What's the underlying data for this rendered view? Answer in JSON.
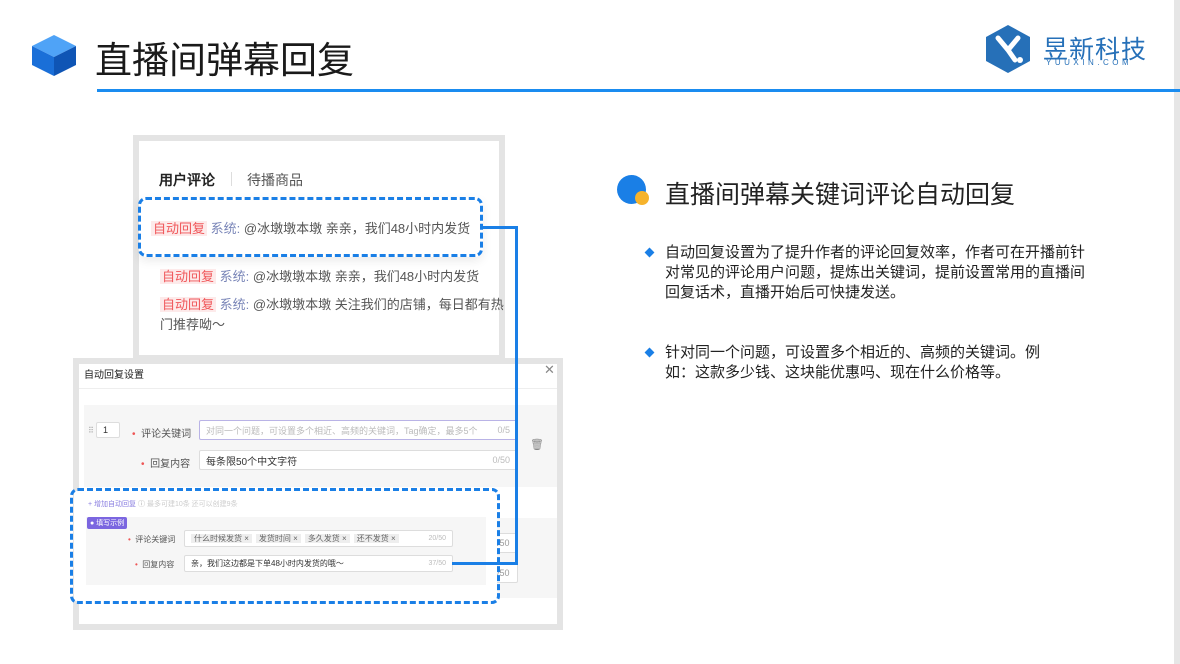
{
  "header": {
    "title": "直播间弹幕回复",
    "logo_name": "昱新科技",
    "logo_domain": "YUUXIN.COM"
  },
  "colors": {
    "accent": "#1a8cf0",
    "tag_red": "#f0575a",
    "logo_blue": "#2670b8"
  },
  "comments_panel": {
    "tabs": [
      "用户评论",
      "待播商品"
    ],
    "comments": [
      {
        "tag": "自动回复",
        "sender": "系统:",
        "text": "@冰墩墩本墩 亲亲，我们48小时内发货"
      },
      {
        "tag": "自动回复",
        "sender": "系统:",
        "text": "@冰墩墩本墩 亲亲，我们48小时内发货"
      },
      {
        "tag": "自动回复",
        "sender": "系统:",
        "text": "@冰墩墩本墩 关注我们的店铺，每日都有热",
        "text2": "门推荐呦～"
      }
    ]
  },
  "dialog": {
    "title": "自动回复设置",
    "index": "1",
    "keyword_label": "评论关键词",
    "keyword_placeholder": "对同一个问题，可设置多个相近、高频的关键词，Tag确定，最多5个",
    "keyword_count": "0/5",
    "reply_label": "回复内容",
    "reply_placeholder": "每条限50个中文字符",
    "reply_count": "0/50",
    "add_label": "+ 增加自动回复",
    "add_hint": "最多可建10条 还可以创建9条",
    "example_badge": "填写示例",
    "example_keywords": [
      "什么时候发货",
      "发货时间",
      "多久发货",
      "还不发货"
    ],
    "example_keyword_count": "20/50",
    "example_reply": "亲，我们这边都是下单48小时内发货的哦～",
    "example_reply_count": "37/50",
    "behind_count1": "/50",
    "behind_count2": "/50"
  },
  "feature": {
    "heading": "直播间弹幕关键词评论自动回复",
    "bullets": [
      [
        "自动回复设置为了提升作者的评论回复效率，作者可在开播前针",
        "对常见的评论用户问题，提炼出关键词，提前设置常用的直播间",
        "回复话术，直播开始后可快捷发送。"
      ],
      [
        "针对同一个问题，可设置多个相近的、高频的关键词。例",
        "如：这款多少钱、这块能优惠吗、现在什么价格等。"
      ]
    ]
  }
}
